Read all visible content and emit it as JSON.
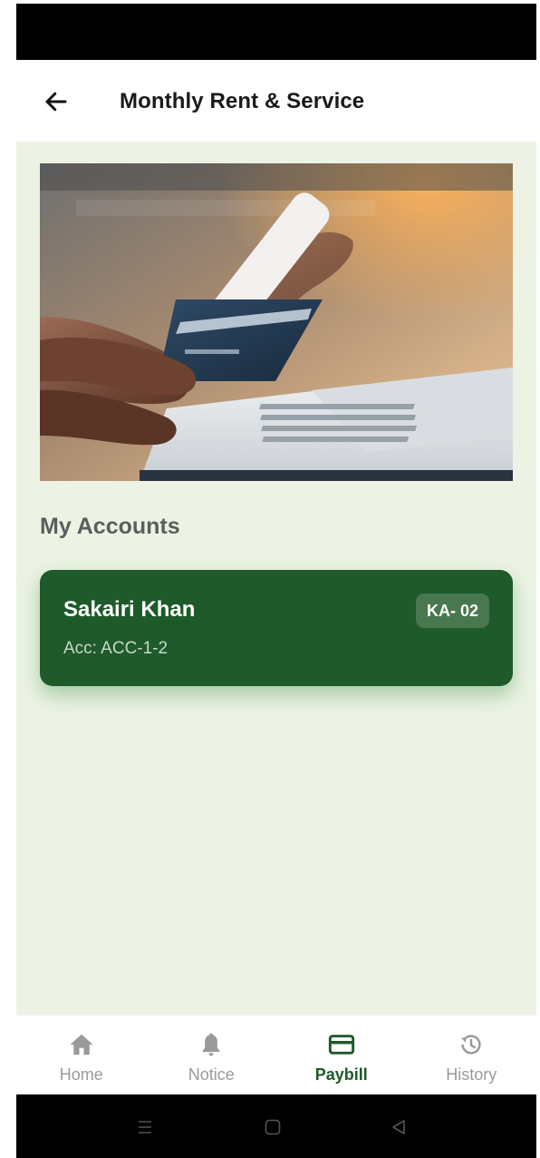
{
  "app_bar": {
    "title": "Monthly Rent & Service",
    "back_icon": "arrow-left-icon"
  },
  "banner": {
    "icon": "hand-card-phone-laptop-illustration"
  },
  "accounts": {
    "section_title": "My Accounts",
    "items": [
      {
        "name": "Sakairi Khan",
        "account": "Acc: ACC-1-2",
        "badge": "KA- 02"
      }
    ]
  },
  "bottom_nav": {
    "items": [
      {
        "label": "Home",
        "icon": "home-icon"
      },
      {
        "label": "Notice",
        "icon": "bell-icon"
      },
      {
        "label": "Paybill",
        "icon": "credit-card-icon",
        "active": true
      },
      {
        "label": "History",
        "icon": "history-icon"
      }
    ]
  },
  "colors": {
    "primary": "#1e5a2a",
    "background": "#ecf3e4",
    "badge": "#49774f",
    "inactive": "#9a9a9a"
  }
}
